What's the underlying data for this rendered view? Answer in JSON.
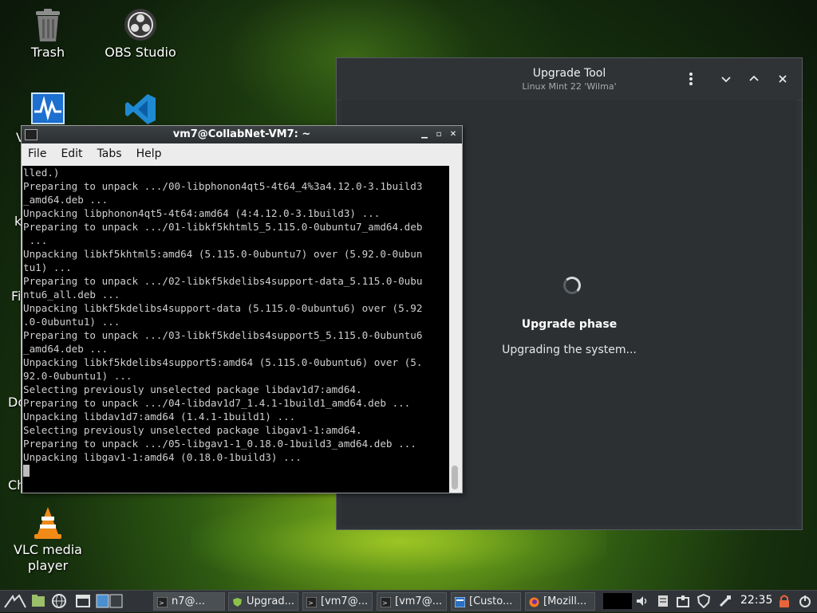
{
  "desktop": {
    "icons": [
      {
        "label": "Trash",
        "icon": "trash-icon"
      },
      {
        "label": "OBS Studio",
        "icon": "obs-icon"
      },
      {
        "label": "VLC media player",
        "icon": "vlc-icon"
      }
    ],
    "partial_labels": [
      "V",
      "k",
      "Fi",
      "Do",
      "Ch"
    ]
  },
  "upgrade_tool": {
    "title": "Upgrade Tool",
    "subtitle": "Linux Mint 22 'Wilma'",
    "phase_title": "Upgrade phase",
    "phase_text": "Upgrading the system..."
  },
  "terminal": {
    "title": "vm7@CollabNet-VM7: ~",
    "menu": [
      "File",
      "Edit",
      "Tabs",
      "Help"
    ],
    "lines": [
      "lled.)",
      "Preparing to unpack .../00-libphonon4qt5-4t64_4%3a4.12.0-3.1build3",
      "_amd64.deb ...",
      "Unpacking libphonon4qt5-4t64:amd64 (4:4.12.0-3.1build3) ...",
      "Preparing to unpack .../01-libkf5khtml5_5.115.0-0ubuntu7_amd64.deb",
      " ...",
      "Unpacking libkf5khtml5:amd64 (5.115.0-0ubuntu7) over (5.92.0-0ubun",
      "tu1) ...",
      "Preparing to unpack .../02-libkf5kdelibs4support-data_5.115.0-0ubu",
      "ntu6_all.deb ...",
      "Unpacking libkf5kdelibs4support-data (5.115.0-0ubuntu6) over (5.92",
      ".0-0ubuntu1) ...",
      "Preparing to unpack .../03-libkf5kdelibs4support5_5.115.0-0ubuntu6",
      "_amd64.deb ...",
      "Unpacking libkf5kdelibs4support5:amd64 (5.115.0-0ubuntu6) over (5.",
      "92.0-0ubuntu1) ...",
      "Selecting previously unselected package libdav1d7:amd64.",
      "Preparing to unpack .../04-libdav1d7_1.4.1-1build1_amd64.deb ...",
      "Unpacking libdav1d7:amd64 (1.4.1-1build1) ...",
      "Selecting previously unselected package libgav1-1:amd64.",
      "Preparing to unpack .../05-libgav1-1_0.18.0-1build3_amd64.deb ...",
      "Unpacking libgav1-1:amd64 (0.18.0-1build3) ..."
    ]
  },
  "taskbar": {
    "tasks": [
      {
        "label": "n7@...",
        "icon": "terminal-icon"
      },
      {
        "label": "Upgrad...",
        "icon": "shield-icon"
      },
      {
        "label": "[vm7@...",
        "icon": "terminal-icon"
      },
      {
        "label": "[vm7@...",
        "icon": "terminal-icon"
      },
      {
        "label": "[Custo...",
        "icon": "window-icon"
      },
      {
        "label": "[Mozill...",
        "icon": "firefox-icon"
      }
    ],
    "clock": "22:35"
  },
  "colors": {
    "terminal_bg": "#000000",
    "upgrade_bg": "#2f3336",
    "taskbar_bg": "#303438"
  }
}
